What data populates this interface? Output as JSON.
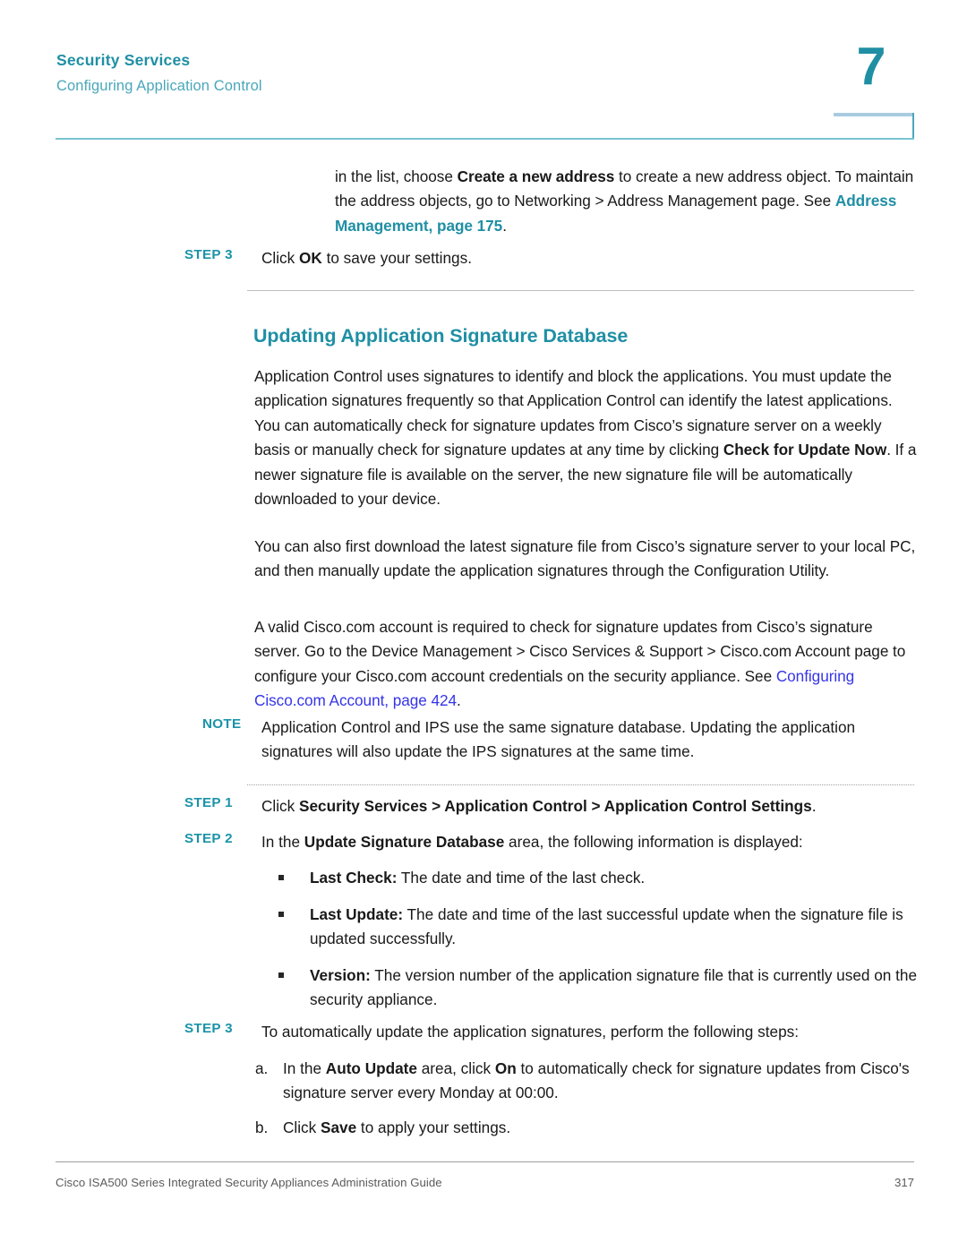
{
  "header": {
    "title": "Security Services",
    "subtitle": "Configuring Application Control",
    "chapter_number": "7",
    "accent_teal": "#1F8FA4",
    "accent_light_teal": "#4AA7BA",
    "rule_color": "#79C4CE",
    "box_top_color": "#A8CBE2"
  },
  "intro": {
    "p1_a": "in the list, choose ",
    "p1_b": "Create a new address",
    "p1_c": " to create a new address object. To maintain the address objects, go to Networking > Address Management page. See ",
    "p1_link": "Address Management, page 175",
    "p1_d": "."
  },
  "step_top": {
    "label": "STEP 3",
    "body_a": "Click ",
    "body_b": "OK",
    "body_c": " to save your settings."
  },
  "section": {
    "heading": "Updating Application Signature Database"
  },
  "paragraphs": {
    "p1_a": "Application Control uses signatures to identify and block the applications. You must update the application signatures frequently so that Application Control can identify the latest applications. You can automatically check for signature updates from Cisco’s signature server on a weekly basis or manually check for signature updates at any time by clicking ",
    "p1_b": "Check for Update Now",
    "p1_c": ". If a newer signature file is available on the server, the new signature file will be automatically downloaded to your device.",
    "p2": "You can also first download the latest signature file from Cisco’s signature server to your local PC, and then manually update the application signatures through the Configuration Utility.",
    "p3_a": "A valid Cisco.com account is required to check for signature updates from Cisco’s signature server. Go to the Device Management > Cisco Services & Support > Cisco.com Account page to configure your Cisco.com account credentials on the security appliance. See ",
    "p3_link": "Configuring Cisco.com Account, page 424",
    "p3_b": "."
  },
  "note": {
    "label": "NOTE",
    "body": "Application Control and IPS use the same signature database. Updating the application signatures will also update the IPS signatures at the same time."
  },
  "steps": [
    {
      "label": "STEP 1",
      "body_a": "Click ",
      "body_b": "Security Services > Application Control > Application Control Settings",
      "body_c": "."
    },
    {
      "label": "STEP 2",
      "body_a": "In the ",
      "body_b": "Update Signature Database",
      "body_c": " area, the following information is displayed:"
    },
    {
      "label": "STEP 3",
      "body_a": "To automatically update the application signatures, perform the following steps:",
      "body_b": "",
      "body_c": ""
    }
  ],
  "bullets": [
    {
      "term": "Last Check:",
      "text": " The date and time of the last check."
    },
    {
      "term": "Last Update:",
      "text": " The date and time of the last successful update when the signature file is updated successfully."
    },
    {
      "term": "Version:",
      "text": " The version number of the application signature file that is currently used on the security appliance."
    }
  ],
  "substeps": [
    {
      "marker": "a.",
      "text_a": "In the ",
      "text_b": "Auto Update",
      "text_c": " area, click ",
      "text_d": "On",
      "text_e": " to automatically check for signature updates from Cisco's signature server every Monday at 00:00."
    },
    {
      "marker": "b.",
      "text_a": "Click ",
      "text_b": "Save",
      "text_c": " to apply your settings.",
      "text_d": "",
      "text_e": ""
    }
  ],
  "footer": {
    "left": "Cisco ISA500 Series Integrated Security Appliances Administration Guide",
    "page_number": "317"
  }
}
